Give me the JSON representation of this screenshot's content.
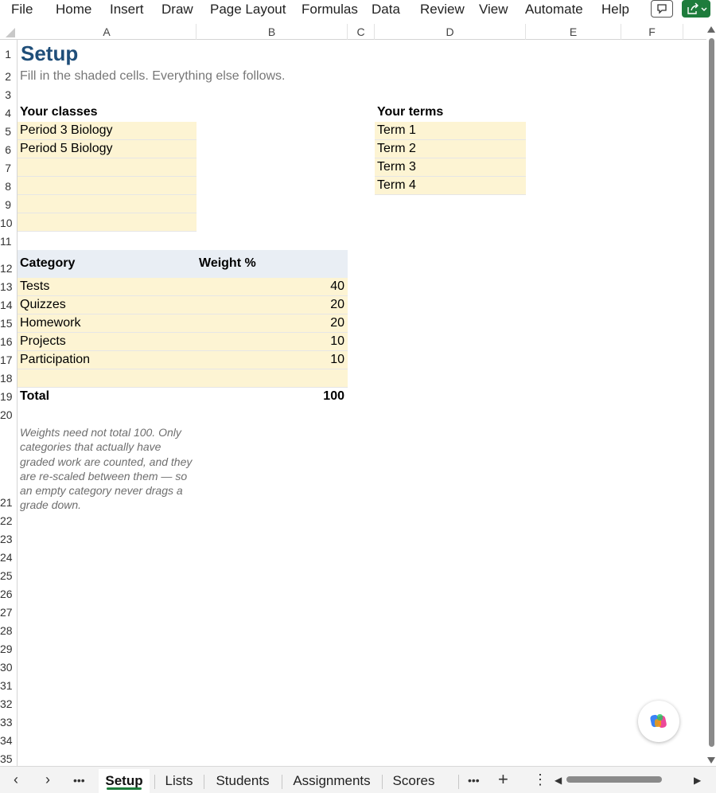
{
  "menu": [
    "File",
    "Home",
    "Insert",
    "Draw",
    "Page Layout",
    "Formulas",
    "Data",
    "Review",
    "View",
    "Automate",
    "Help"
  ],
  "columns": [
    "A",
    "B",
    "C",
    "D",
    "E",
    "F"
  ],
  "rows": [
    "1",
    "2",
    "3",
    "4",
    "5",
    "6",
    "7",
    "8",
    "9",
    "10",
    "11",
    "12",
    "13",
    "14",
    "15",
    "16",
    "17",
    "18",
    "19",
    "20",
    "21",
    "22",
    "23",
    "24",
    "25",
    "26",
    "27",
    "28",
    "29",
    "30",
    "31",
    "32",
    "33",
    "34",
    "35"
  ],
  "setup": {
    "title": "Setup",
    "subtitle": "Fill in the shaded cells. Everything else follows.",
    "classes_header": "Your classes",
    "classes": [
      "Period 3 Biology",
      "Period 5 Biology",
      "",
      "",
      "",
      ""
    ],
    "terms_header": "Your terms",
    "terms": [
      "Term 1",
      "Term 2",
      "Term 3",
      "Term 4"
    ],
    "category_header": "Category",
    "weight_header": "Weight %",
    "categories": [
      {
        "name": "Tests",
        "weight": "40"
      },
      {
        "name": "Quizzes",
        "weight": "20"
      },
      {
        "name": "Homework",
        "weight": "20"
      },
      {
        "name": "Projects",
        "weight": "10"
      },
      {
        "name": "Participation",
        "weight": "10"
      },
      {
        "name": "",
        "weight": ""
      }
    ],
    "total_label": "Total",
    "total_value": "100",
    "note": "Weights need not total 100. Only categories that actually have graded work are counted, and they are re-scaled between them — so an empty category never drags a grade down."
  },
  "tabs": {
    "sheets": [
      "Setup",
      "Lists",
      "Students",
      "Assignments",
      "Scores"
    ],
    "active": "Setup",
    "more": "•••",
    "add": "+",
    "options": "⋮"
  },
  "colors": {
    "title": "#1f4e79",
    "shade": "#fdf4d3",
    "header_band": "#e9eef4",
    "accent": "#1e7c3c"
  }
}
